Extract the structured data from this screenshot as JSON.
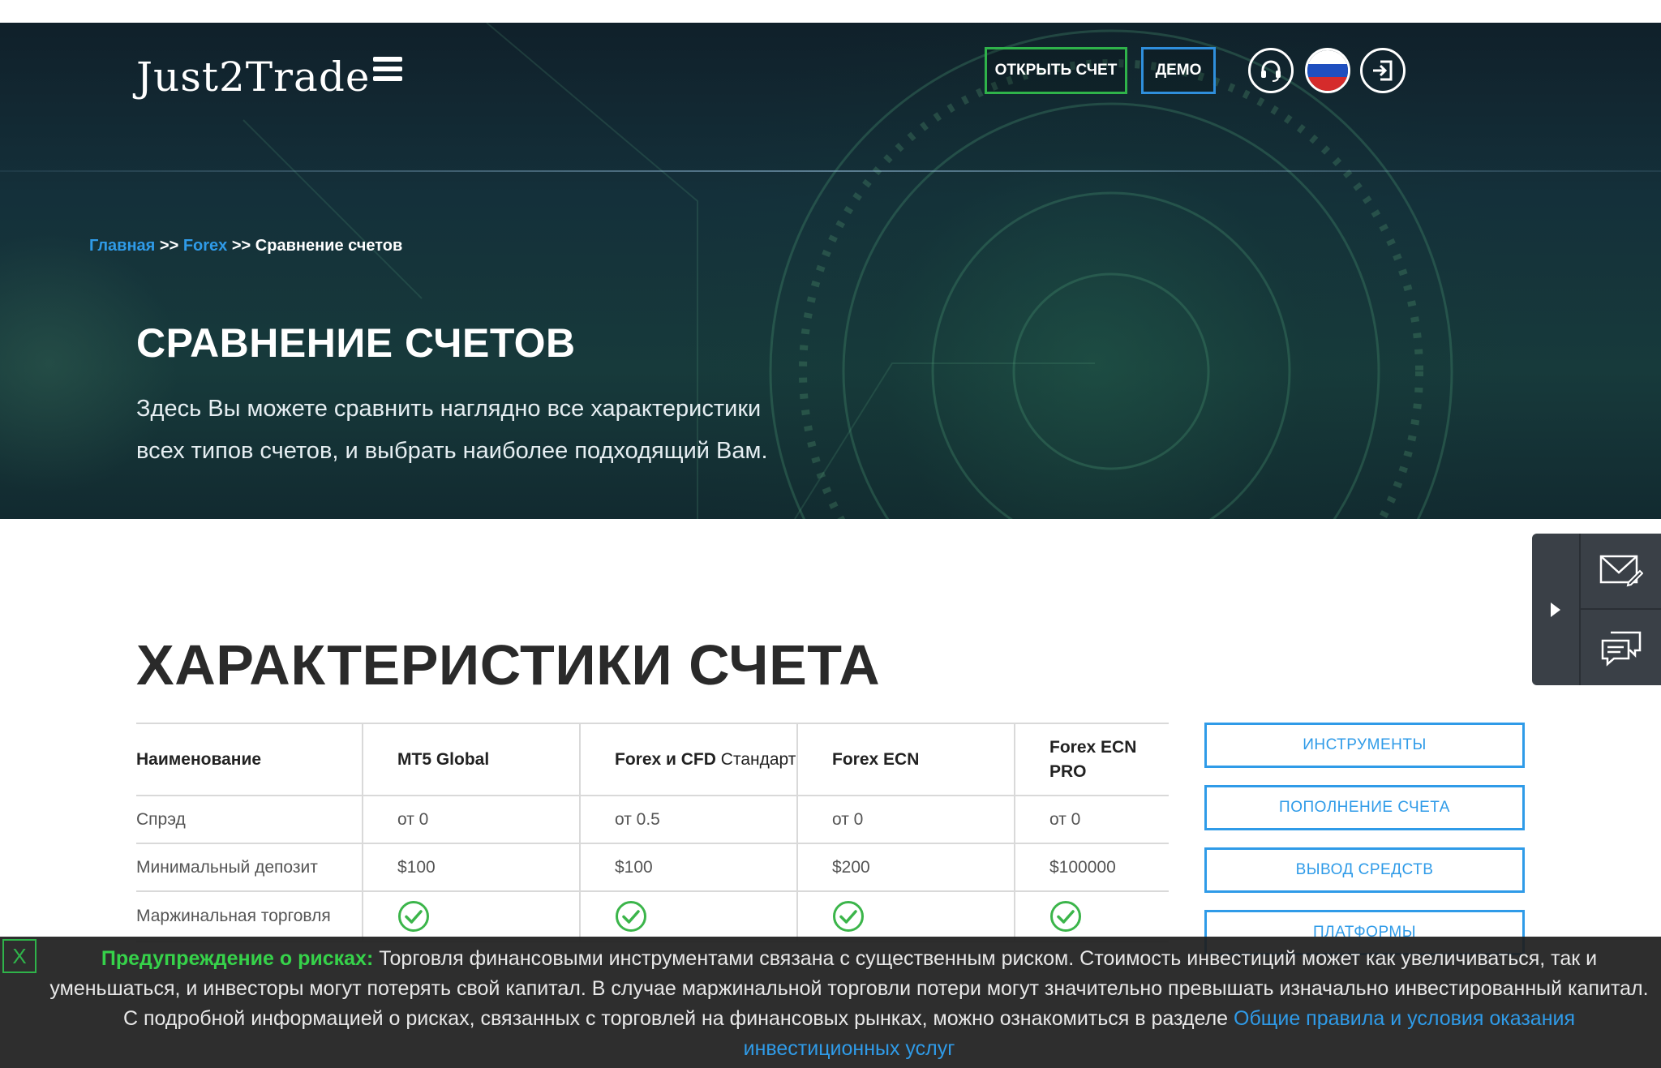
{
  "header": {
    "logo": "Just2Trade",
    "open_account_label": "ОТКРЫТЬ СЧЕТ",
    "demo_label": "ДЕМО",
    "icons": [
      "headset-icon",
      "russian-flag-icon",
      "login-icon",
      "hamburger-menu-icon"
    ]
  },
  "breadcrumb": {
    "home": "Главная",
    "sep1": ">>",
    "forex": "Forex",
    "sep2": ">>",
    "current": "Сравнение счетов"
  },
  "hero": {
    "title": "СРАВНЕНИЕ СЧЕТОВ",
    "subtitle": "Здесь Вы можете сравнить наглядно все характеристики всех типов счетов, и выбрать наиболее подходящий Вам."
  },
  "section": {
    "title": "ХАРАКТЕРИСТИКИ СЧЕТА"
  },
  "table": {
    "headers": {
      "name": "Наименование",
      "col1": "MT5 Global",
      "col2_bold": "Forex и CFD",
      "col2_light": " Стандарт",
      "col3": "Forex ECN",
      "col4": "Forex ECN PRO"
    },
    "rows": [
      {
        "label": "Спрэд",
        "values": [
          "от 0",
          "от 0.5",
          "от 0",
          "от 0"
        ]
      },
      {
        "label": "Минимальный депозит",
        "values": [
          "$100",
          "$100",
          "$200",
          "$100000"
        ]
      },
      {
        "label": "Маржинальная торговля",
        "values": [
          "check",
          "check",
          "check",
          "check"
        ]
      }
    ]
  },
  "sidebar_buttons": {
    "instruments": "ИНСТРУМЕНТЫ",
    "deposit": "ПОПОЛНЕНИЕ СЧЕТА",
    "withdraw": "ВЫВОД СРЕДСТВ",
    "platforms": "ПЛАТФОРМЫ"
  },
  "risk_banner": {
    "close_label": "X",
    "label": "Предупреждение о рисках:",
    "text": " Торговля финансовыми инструментами связана с существенным риском. Стоимость инвестиций может как увеличиваться, так и уменьшаться, и инвесторы могут потерять свой капитал. В случае маржинальной торговли потери могут значительно превышать изначально инвестированный капитал. С подробной информацией о рисках, связанных с торговлей на финансовых рынках, можно ознакомиться в разделе ",
    "link": "Общие правила и условия оказания инвестиционных услуг"
  },
  "colors": {
    "accent_blue": "#2f9be8",
    "accent_green": "#2fb34a",
    "check_green": "#3bb54a"
  }
}
